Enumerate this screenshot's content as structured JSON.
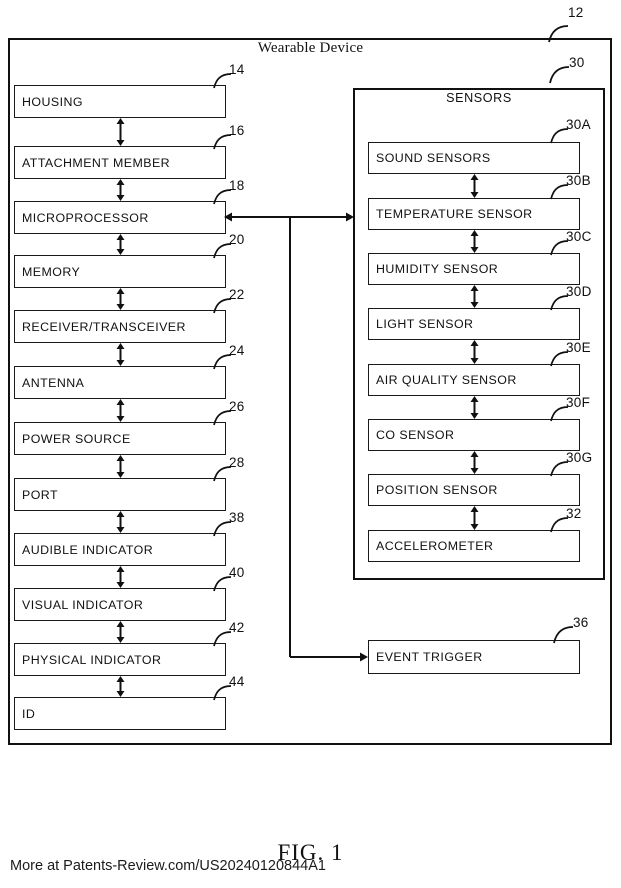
{
  "figure": {
    "label": "FIG. 1",
    "watermark": "More at Patents-Review.com/US20240120844A1",
    "device_ref": "12",
    "device_title": "Wearable Device"
  },
  "device_blocks": [
    {
      "label": "HOUSING",
      "ref": "14"
    },
    {
      "label": "ATTACHMENT MEMBER",
      "ref": "16"
    },
    {
      "label": "MICROPROCESSOR",
      "ref": "18"
    },
    {
      "label": "MEMORY",
      "ref": "20"
    },
    {
      "label": "RECEIVER/TRANSCEIVER",
      "ref": "22"
    },
    {
      "label": "ANTENNA",
      "ref": "24"
    },
    {
      "label": "POWER SOURCE",
      "ref": "26"
    },
    {
      "label": "PORT",
      "ref": "28"
    },
    {
      "label": "AUDIBLE INDICATOR",
      "ref": "38"
    },
    {
      "label": "VISUAL INDICATOR",
      "ref": "40"
    },
    {
      "label": "PHYSICAL INDICATOR",
      "ref": "42"
    },
    {
      "label": "ID",
      "ref": "44"
    }
  ],
  "sensors": {
    "title": "SENSORS",
    "ref": "30",
    "items": [
      {
        "label": "SOUND SENSORS",
        "ref": "30A"
      },
      {
        "label": "TEMPERATURE SENSOR",
        "ref": "30B"
      },
      {
        "label": "HUMIDITY SENSOR",
        "ref": "30C"
      },
      {
        "label": "LIGHT SENSOR",
        "ref": "30D"
      },
      {
        "label": "AIR QUALITY SENSOR",
        "ref": "30E"
      },
      {
        "label": "CO SENSOR",
        "ref": "30F"
      },
      {
        "label": "POSITION SENSOR",
        "ref": "30G"
      },
      {
        "label": "ACCELEROMETER",
        "ref": "32"
      }
    ]
  },
  "event_trigger": {
    "label": "EVENT TRIGGER",
    "ref": "36"
  },
  "colors": {
    "ink": "#111111",
    "paper": "#ffffff"
  }
}
